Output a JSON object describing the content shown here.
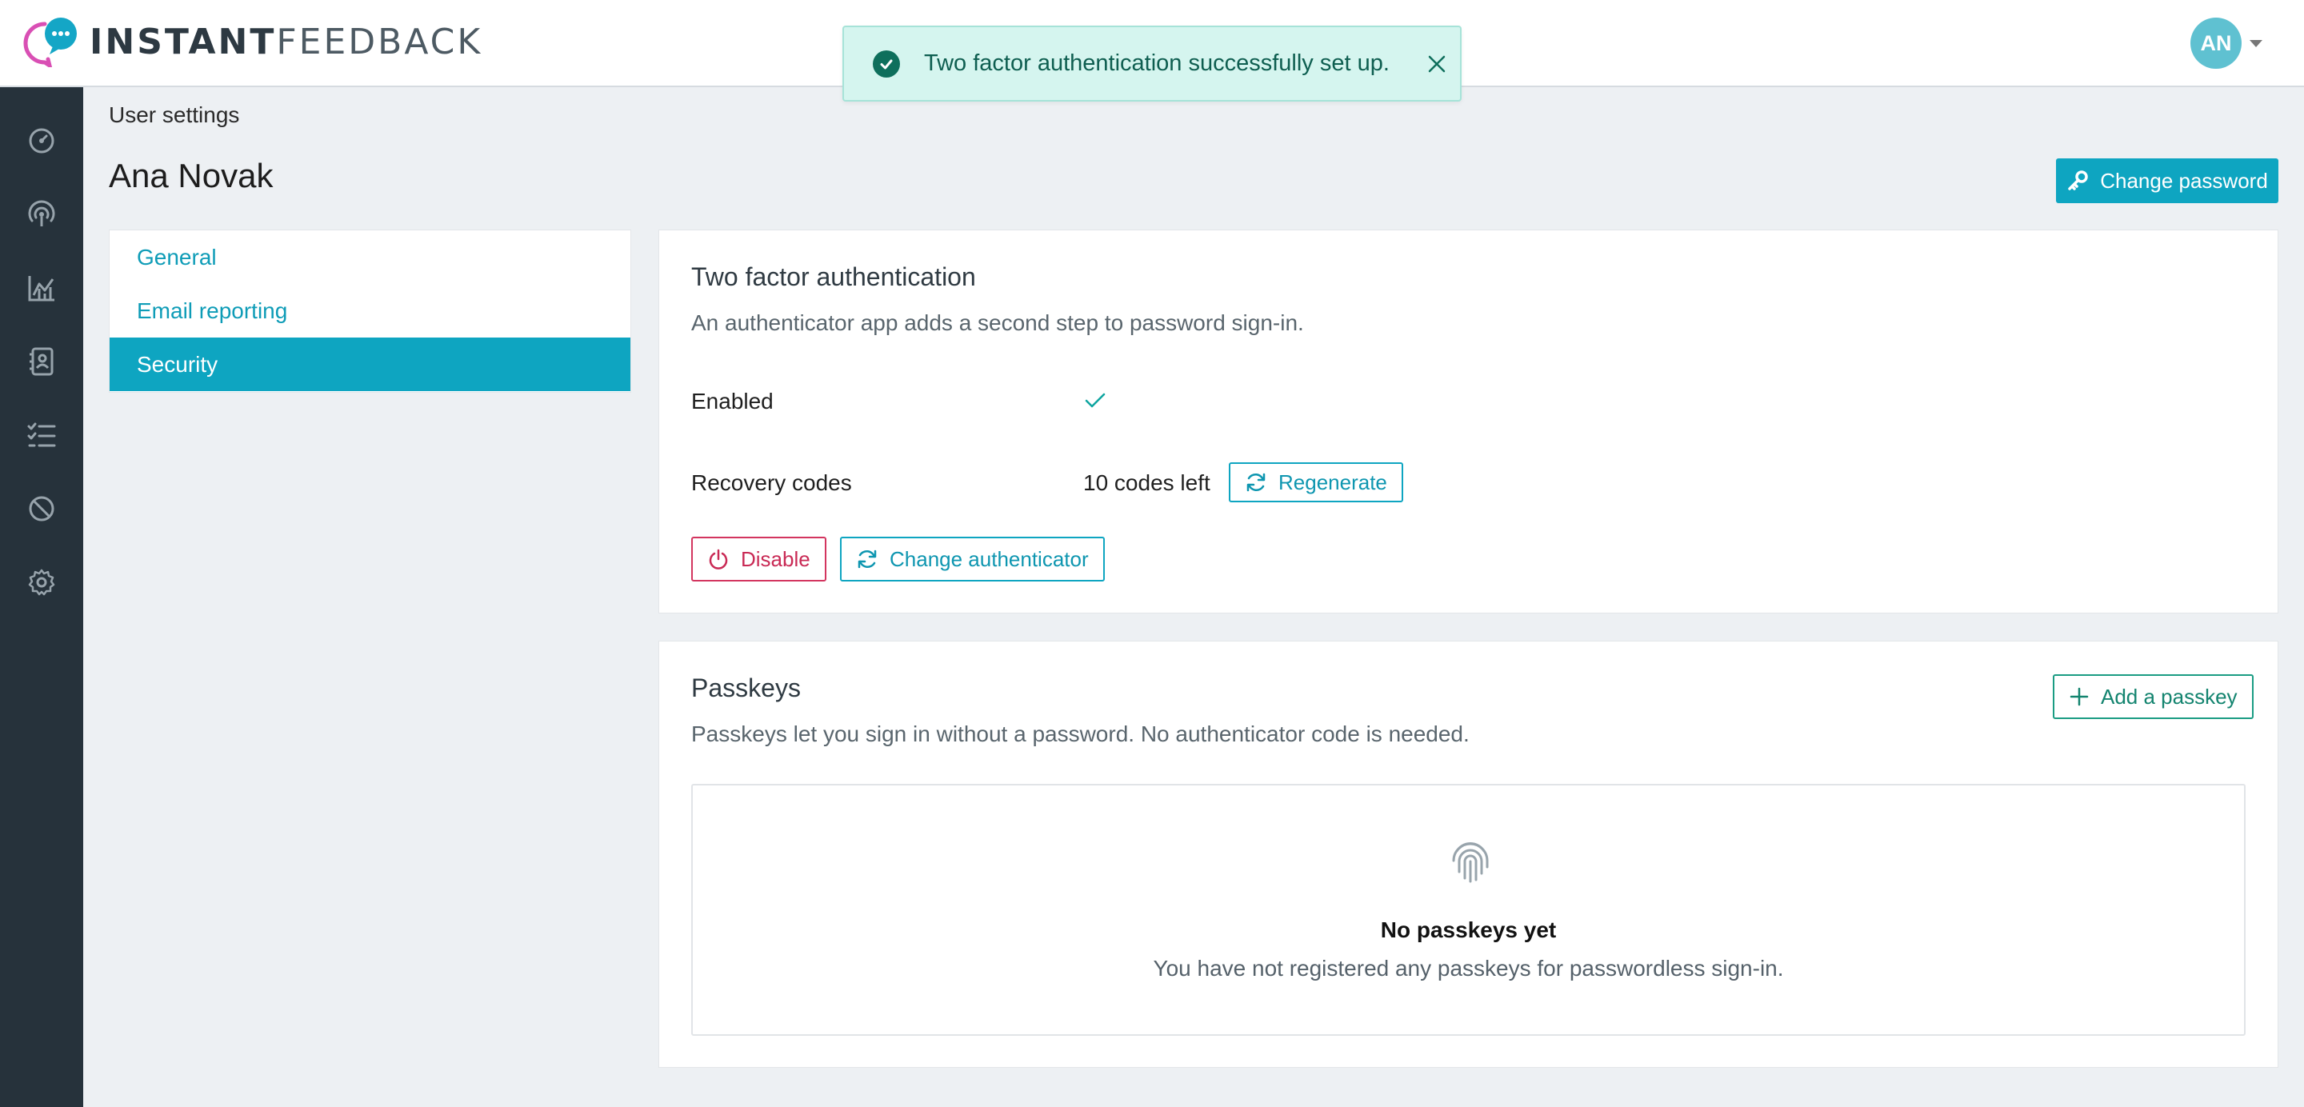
{
  "app": {
    "logo_bold": "INSTANT",
    "logo_light": "FEEDBACK",
    "brand_color": "#0ea5c1"
  },
  "user": {
    "initials": "AN"
  },
  "toast": {
    "message": "Two factor authentication successfully set up.",
    "icon": "check-circle-icon",
    "close_icon": "close-icon"
  },
  "sidebar": {
    "items": [
      {
        "icon": "dashboard-icon"
      },
      {
        "icon": "broadcast-icon"
      },
      {
        "icon": "chart-icon"
      },
      {
        "icon": "contacts-icon"
      },
      {
        "icon": "checklist-icon"
      },
      {
        "icon": "block-icon"
      },
      {
        "icon": "gear-icon"
      }
    ]
  },
  "page": {
    "breadcrumb": "User settings",
    "title": "Ana Novak",
    "change_password_label": "Change password"
  },
  "settings_menu": {
    "items": [
      {
        "label": "General",
        "active": false
      },
      {
        "label": "Email reporting",
        "active": false
      },
      {
        "label": "Security",
        "active": true
      }
    ]
  },
  "two_factor": {
    "title": "Two factor authentication",
    "description": "An authenticator app adds a second step to password sign-in.",
    "enabled_label": "Enabled",
    "recovery_label": "Recovery codes",
    "recovery_value": "10 codes left",
    "regenerate_label": "Regenerate",
    "disable_label": "Disable",
    "change_authenticator_label": "Change authenticator"
  },
  "passkeys": {
    "title": "Passkeys",
    "description": "Passkeys let you sign in without a password. No authenticator code is needed.",
    "add_label": "Add a passkey",
    "empty_title": "No passkeys yet",
    "empty_text": "You have not registered any passkeys for passwordless sign-in."
  }
}
